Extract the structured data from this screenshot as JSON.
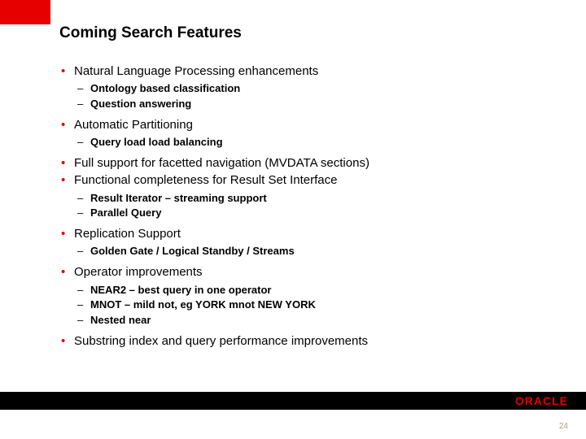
{
  "title": "Coming Search Features",
  "bullets": {
    "b0": "Natural Language Processing enhancements",
    "b0s0": "Ontology based classification",
    "b0s1": "Question answering",
    "b1": "Automatic Partitioning",
    "b1s0": "Query load load balancing",
    "b2": "Full support for facetted navigation (MVDATA sections)",
    "b3": "Functional completeness for Result Set Interface",
    "b3s0": "Result Iterator – streaming support",
    "b3s1": "Parallel Query",
    "b4": "Replication Support",
    "b4s0": "Golden Gate / Logical Standby / Streams",
    "b5": "Operator improvements",
    "b5s0": "NEAR2 – best query in one operator",
    "b5s1": "MNOT – mild not, eg YORK mnot NEW YORK",
    "b5s2": "Nested near",
    "b6": "Substring index and query performance improvements"
  },
  "logo_text": "ORACLE",
  "page_number": "24"
}
